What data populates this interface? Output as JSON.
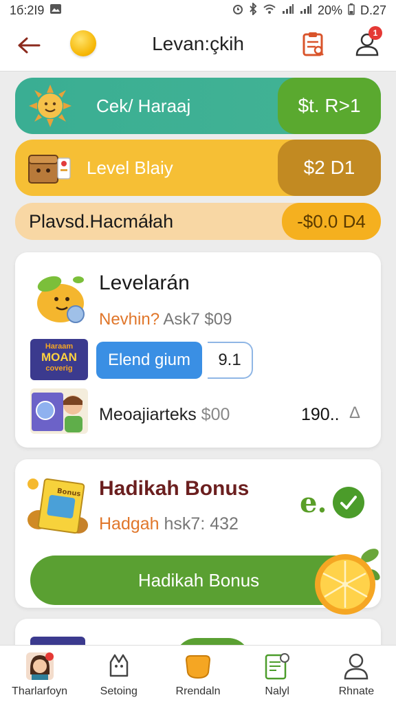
{
  "status_bar": {
    "time": "1б:2І9",
    "battery_percent": "20%",
    "clock_right": "D.27"
  },
  "header": {
    "title": "Levan:çkih",
    "notification_count": "1"
  },
  "banners": [
    {
      "label": "Cеk/ Haraaj",
      "value": "$t. R>1",
      "color": "#3aae93"
    },
    {
      "label": "Level Blaiy",
      "value": "$2 D1",
      "color": "#f6bf35"
    },
    {
      "label": "Plavsd.Hacmáłah",
      "value": "-$0.0 D4",
      "color": "#f8d7a4"
    }
  ],
  "card1": {
    "title": "Levelarán",
    "subtitle_accent": "Nevhin?",
    "subtitle_rest": " Ask7 $09",
    "thumb_text": [
      "Haraam",
      "MOAN",
      "coverig"
    ],
    "chip_label": "Elend gium",
    "field_value": "9.1",
    "row3_label": "Meoajiarteks",
    "row3_label_muted": " $00",
    "row3_value": "190..",
    "row3_arrow": "Δ"
  },
  "card2": {
    "title": "Hadikah Bonus",
    "subtitle_accent": "Hadgah",
    "subtitle_rest": " hsk7: 432",
    "mark": "e.",
    "button_label": "Hadikah Bonus",
    "package_label": "Bonus"
  },
  "bottom_nav": [
    {
      "label": "Tharlarfoyn",
      "icon": "avatar-icon"
    },
    {
      "label": "Setoing",
      "icon": "game-icon"
    },
    {
      "label": "Rrendaln",
      "icon": "bag-icon"
    },
    {
      "label": "Nalyl",
      "icon": "report-icon"
    },
    {
      "label": "Rhnate",
      "icon": "user-icon"
    }
  ]
}
